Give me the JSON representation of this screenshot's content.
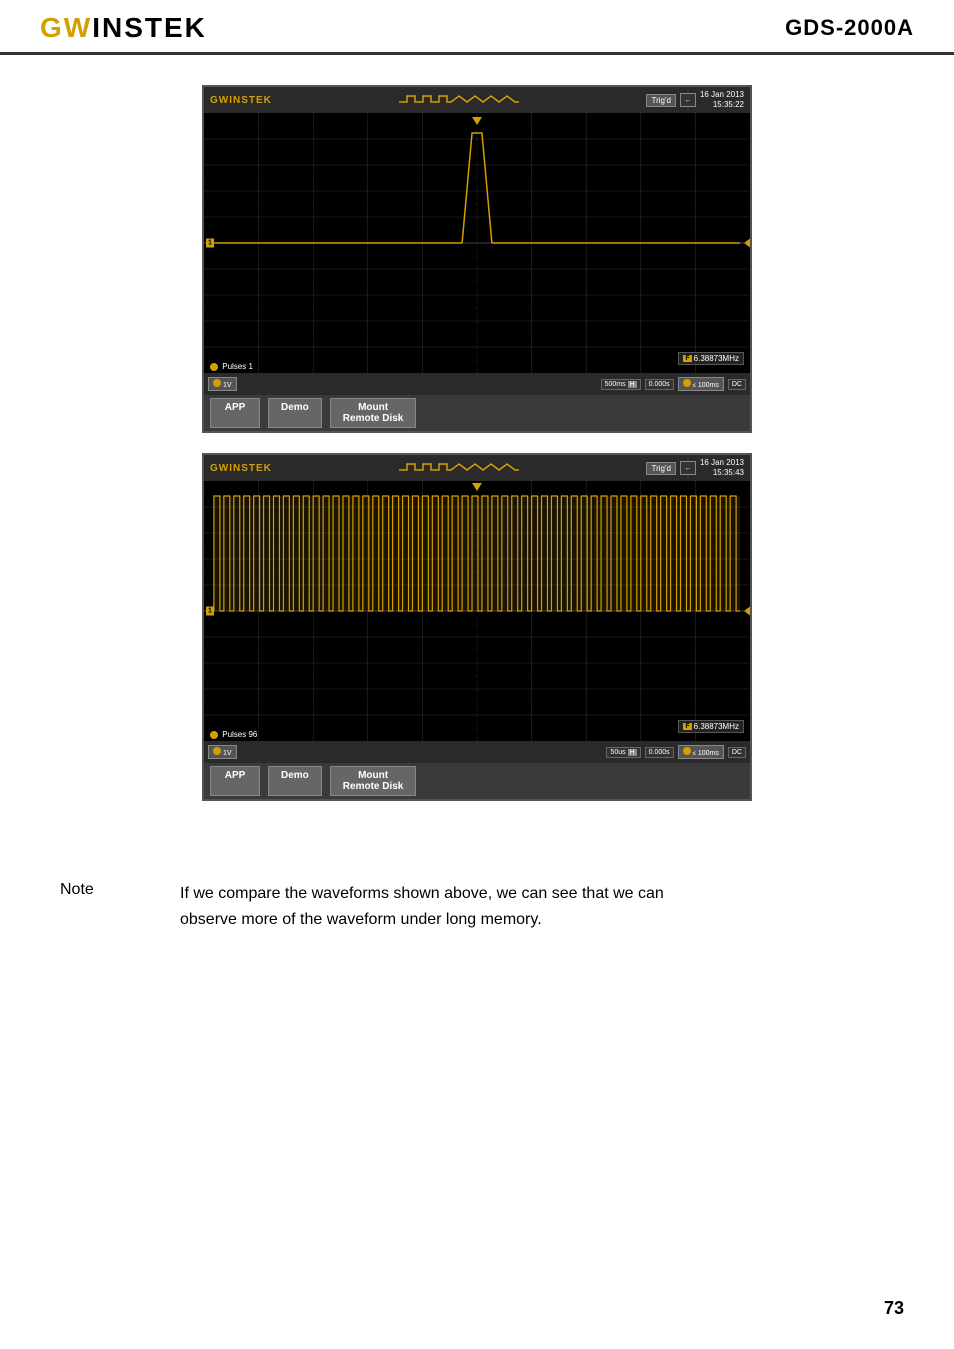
{
  "header": {
    "logo_gw": "GW",
    "logo_instek": "INSTEK",
    "model": "GDS-2000A"
  },
  "scope1": {
    "brand": "GWINSTEK",
    "trig_label": "Trig'd",
    "date": "16 Jan 2013",
    "time": "15:35:22",
    "freq": "6.38873MHz",
    "freq_icon": "F",
    "pulses_label": "Pulses 1",
    "ch_marker": "1",
    "timescale": "500ms",
    "hold_icon": "H",
    "time_val": "0.000s",
    "ch_val": "1V",
    "timebase": "100ms",
    "coupling": "DC",
    "btn_app": "APP",
    "btn_demo": "Demo",
    "btn_mount": "Mount",
    "btn_mount2": "Remote Disk"
  },
  "scope2": {
    "brand": "GWINSTEK",
    "trig_label": "Trig'd",
    "date": "16 Jan 2013",
    "time": "15:35:43",
    "freq": "6.38873MHz",
    "freq_icon": "F",
    "pulses_label": "Pulses 96",
    "ch_marker": "1",
    "timescale": "50us",
    "hold_icon": "H",
    "time_val": "0.000s",
    "ch_val": "1V",
    "timebase": "100ms",
    "coupling": "DC",
    "btn_app": "APP",
    "btn_demo": "Demo",
    "btn_mount": "Mount",
    "btn_mount2": "Remote Disk"
  },
  "note": {
    "label": "Note",
    "text": "If we compare the waveforms shown above, we can see that we can observe more of the waveform under long memory."
  },
  "page": {
    "number": "73"
  }
}
